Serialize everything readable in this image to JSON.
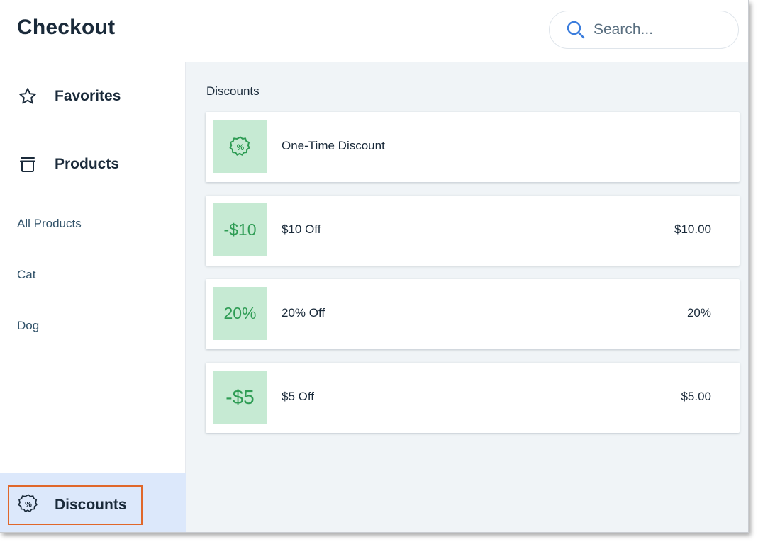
{
  "header": {
    "title": "Checkout",
    "search_placeholder": "Search...",
    "search_icon": "search-icon"
  },
  "sidebar": {
    "favorites": {
      "label": "Favorites",
      "icon": "star-icon"
    },
    "products": {
      "label": "Products",
      "icon": "products-icon"
    },
    "categories": [
      "All Products",
      "Cat",
      "Dog"
    ],
    "discounts": {
      "label": "Discounts",
      "icon": "discount-badge-icon"
    }
  },
  "main": {
    "section_title": "Discounts",
    "discounts": [
      {
        "thumb": "",
        "thumb_icon": "discount-badge-icon",
        "name": "One-Time Discount",
        "price": ""
      },
      {
        "thumb": "-$10",
        "name": "$10 Off",
        "price": "$10.00"
      },
      {
        "thumb": "20%",
        "name": "20% Off",
        "price": "20%"
      },
      {
        "thumb": "-$5",
        "name": "$5 Off",
        "price": "$5.00"
      }
    ]
  },
  "colors": {
    "thumb_bg": "#c6ead3",
    "thumb_text": "#2e9c54",
    "selected_bg": "#dce8fb",
    "highlight_border": "#e0672a",
    "search_icon": "#3b7ddd"
  }
}
